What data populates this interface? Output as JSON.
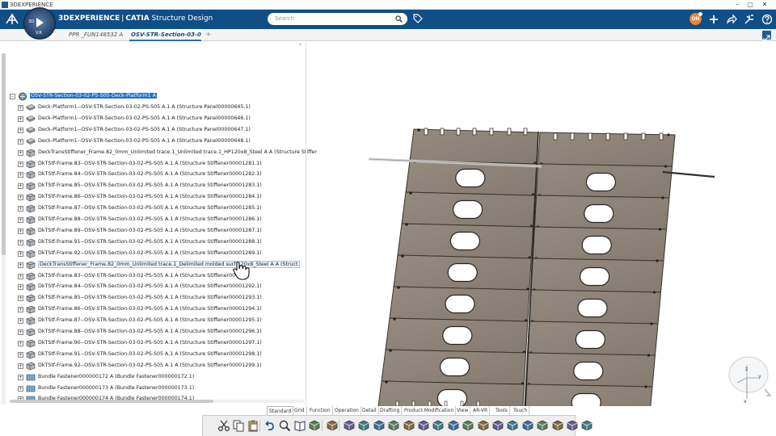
{
  "window": {
    "title": "3DEXPERIENCE",
    "controls": [
      "–",
      "▢",
      "✕"
    ]
  },
  "header": {
    "brand_3d": "3D",
    "brand_experience": "EXPERIENCE",
    "brand_app": "CATIA",
    "brand_module": "Structure Design",
    "compass_number": "3D",
    "compass_version": "V.R",
    "search_placeholder": "Search",
    "avatar_initials": "ON"
  },
  "tabs": [
    {
      "label": "PPR _FUN148532 A",
      "active": false
    },
    {
      "label": "OSV-STR-Section-03-02-P",
      "active": true
    }
  ],
  "tree": {
    "root": "OSV-STR-Section-03-02-PS-S05-Deck-Platform1 A",
    "items": [
      {
        "label": "Deck-Platform1--OSV-STR-Section-03-02-PS-S05 A.1 A (Structure Panel00000645.1)",
        "icon": "panel"
      },
      {
        "label": "Deck-Platform1--OSV-STR-Section-03-02-PS-S05 A.1 A (Structure Panel00000646.1)",
        "icon": "panel"
      },
      {
        "label": "Deck-Platform1--OSV-STR-Section-03-02-PS-S05 A.1 A (Structure Panel00000647.1)",
        "icon": "panel"
      },
      {
        "label": "Deck-Platform1--OSV-STR-Section-03-02-PS-S05 A.1 A (Structure Panel00000648.1)",
        "icon": "panel"
      },
      {
        "label": "DeckTransStiffener_Frame.82_0mm_Unlimited trace.1_Unlimited trace.1_HP120x8_Steel A A (Structure Stiffer",
        "icon": "stiffener"
      },
      {
        "label": "DkTStf-Frame.83--OSV-STR-Section-03-02-PS-S05 A.1 A (Structure Stiffener00001281.1)",
        "icon": "stiffener"
      },
      {
        "label": "DkTStf-Frame.84--OSV-STR-Section-03-02-PS-S05 A.1 A (Structure Stiffener00001282.1)",
        "icon": "stiffener"
      },
      {
        "label": "DkTStf-Frame.85--OSV-STR-Section-03-02-PS-S05 A.1 A (Structure Stiffener00001283.1)",
        "icon": "stiffener"
      },
      {
        "label": "DkTStf-Frame.86--OSV-STR-Section-03-02-PS-S05 A.1 A (Structure Stiffener00001284.1)",
        "icon": "stiffener"
      },
      {
        "label": "DkTStf-Frame.87--OSV-STR-Section-03-02-PS-S05 A.1 A (Structure Stiffener00001285.1)",
        "icon": "stiffener"
      },
      {
        "label": "DkTStf-Frame.88--OSV-STR-Section-03-02-PS-S05 A.1 A (Structure Stiffener00001286.1)",
        "icon": "stiffener"
      },
      {
        "label": "DkTStf-Frame.89--OSV-STR-Section-03-02-PS-S05 A.1 A (Structure Stiffener00001287.1)",
        "icon": "stiffener"
      },
      {
        "label": "DkTStf-Frame.91--OSV-STR-Section-03-02-PS-S05 A.1 A (Structure Stiffener00001288.1)",
        "icon": "stiffener"
      },
      {
        "label": "DkTStf-Frame.92--OSV-STR-Section-03-02-PS-S05 A.1 A (Structure Stiffener00001289.1)",
        "icon": "stiffener"
      },
      {
        "label": "DeckTransStiffener_Frame.82_0mm_Unlimited trace.1_Delimited molded surf      120x8_Steel A A (Struct",
        "icon": "stiffener",
        "hover": true
      },
      {
        "label": "DkTStf-Frame.83--OSV-STR-Section-03-02-PS-S05 A.1 A (Structure Stiffener00      1.1)",
        "icon": "stiffener"
      },
      {
        "label": "DkTStf-Frame.84--OSV-STR-Section-03-02-PS-S05 A.1 A (Structure Stiffener00001292.1)",
        "icon": "stiffener"
      },
      {
        "label": "DkTStf-Frame.85--OSV-STR-Section-03-02-PS-S05 A.1 A (Structure Stiffener00001293.1)",
        "icon": "stiffener"
      },
      {
        "label": "DkTStf-Frame.86--OSV-STR-Section-03-02-PS-S05 A.1 A (Structure Stiffener00001294.1)",
        "icon": "stiffener"
      },
      {
        "label": "DkTStf-Frame.87--OSV-STR-Section-03-02-PS-S05 A.1 A (Structure Stiffener00001295.1)",
        "icon": "stiffener"
      },
      {
        "label": "DkTStf-Frame.88--OSV-STR-Section-03-02-PS-S05 A.1 A (Structure Stiffener00001296.1)",
        "icon": "stiffener"
      },
      {
        "label": "DkTStf-Frame.90--OSV-STR-Section-03-02-PS-S05 A.1 A (Structure Stiffener00001297.1)",
        "icon": "stiffener"
      },
      {
        "label": "DkTStf-Frame.91--OSV-STR-Section-03-02-PS-S05 A.1 A (Structure Stiffener00001298.1)",
        "icon": "stiffener"
      },
      {
        "label": "DkTStf-Frame.92--OSV-STR-Section-03-02-PS-S05 A.1 A (Structure Stiffener00001299.1)",
        "icon": "stiffener"
      },
      {
        "label": "Bundle Fastener000000172 A (Bundle Fastener000000172.1)",
        "icon": "fastener"
      },
      {
        "label": "Bundle Fastener000000173 A (Bundle Fastener000000173.1)",
        "icon": "fastener"
      },
      {
        "label": "Bundle Fastener000000174 A (Bundle Fastener000000174.1)",
        "icon": "fastener"
      }
    ]
  },
  "section_tabs": [
    {
      "label": "Standard",
      "active": true
    },
    {
      "label": "Grid"
    },
    {
      "label": "Function"
    },
    {
      "label": "Operation"
    },
    {
      "label": "Detail"
    },
    {
      "label": "Drafting"
    },
    {
      "label": "Product Modification"
    },
    {
      "label": "View"
    },
    {
      "label": "AR-VR"
    },
    {
      "label": "Tools"
    },
    {
      "label": "Touch"
    }
  ],
  "toolbar_icons": [
    "cut-icon",
    "copy-icon",
    "paste-icon",
    "undo-icon",
    "zoom-icon",
    "book-icon",
    "filter-icon",
    "plate-icon",
    "stiffener-tool-icon",
    "bracket-icon",
    "slot-icon",
    "opening-icon",
    "profile-icon",
    "member-icon",
    "cutout-icon",
    "split-icon",
    "extend-icon",
    "trim-icon",
    "corner-icon",
    "endcut-icon",
    "seam-icon",
    "weld-icon",
    "fastener-icon",
    "panel-icon",
    "part-icon"
  ],
  "colors": {
    "header_bg": "#0f4f86",
    "selection": "#1e6fd0",
    "plate": "#8c8277",
    "plate_edge": "#3a3530"
  },
  "viewport_axes": {
    "z": "z",
    "y": "y",
    "x": "x"
  }
}
